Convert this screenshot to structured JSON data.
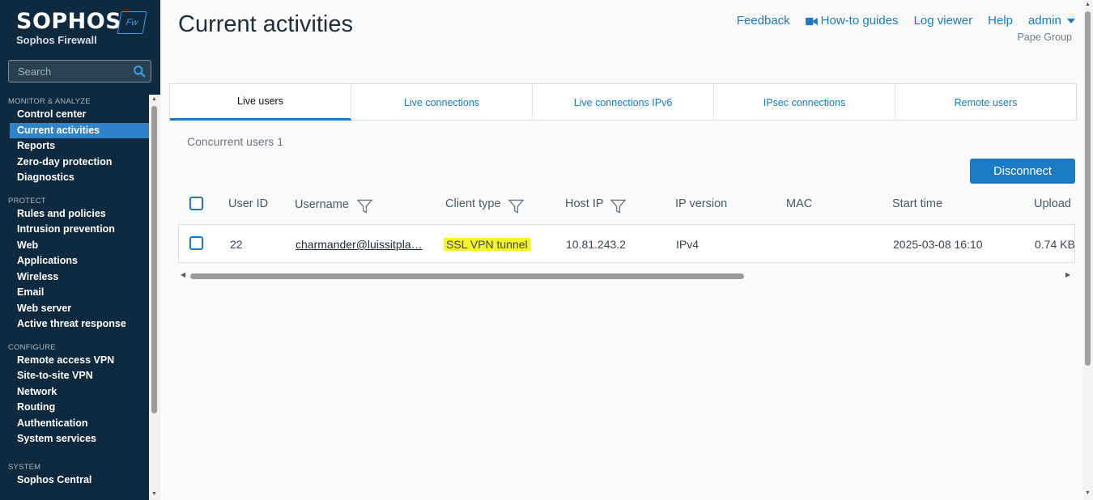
{
  "brand": {
    "logo": "SOPHOS",
    "product": "Sophos Firewall",
    "badge": "Fw"
  },
  "search": {
    "placeholder": "Search"
  },
  "sidebar": {
    "sections": [
      {
        "title": "MONITOR & ANALYZE",
        "items": [
          "Control center",
          "Current activities",
          "Reports",
          "Zero-day protection",
          "Diagnostics"
        ]
      },
      {
        "title": "PROTECT",
        "items": [
          "Rules and policies",
          "Intrusion prevention",
          "Web",
          "Applications",
          "Wireless",
          "Email",
          "Web server",
          "Active threat response"
        ]
      },
      {
        "title": "CONFIGURE",
        "items": [
          "Remote access VPN",
          "Site-to-site VPN",
          "Network",
          "Routing",
          "Authentication",
          "System services"
        ]
      },
      {
        "title": "SYSTEM",
        "items": [
          "Sophos Central"
        ]
      }
    ],
    "active": "Current activities"
  },
  "header": {
    "title": "Current activities",
    "links": {
      "feedback": "Feedback",
      "howto": "How-to guides",
      "logviewer": "Log viewer",
      "help": "Help",
      "admin": "admin"
    },
    "org": "Pape Group"
  },
  "tabs": [
    "Live users",
    "Live connections",
    "Live connections IPv6",
    "IPsec connections",
    "Remote users"
  ],
  "summary": "Concurrent users 1",
  "actions": {
    "disconnect": "Disconnect"
  },
  "table": {
    "columns": [
      "User ID",
      "Username",
      "Client type",
      "Host IP",
      "IP version",
      "MAC",
      "Start time",
      "Upload"
    ],
    "rows": [
      {
        "user_id": "22",
        "username": "charmander@luissitpla…",
        "client_type": "SSL VPN tunnel",
        "host_ip": "10.81.243.2",
        "ip_version": "IPv4",
        "mac": "",
        "start_time": "2025-03-08 16:10",
        "upload": "0.74 KB"
      }
    ]
  },
  "colors": {
    "sidebar_bg": "#0f2a3e",
    "accent": "#1a7ac3",
    "highlight": "#f5f32a"
  }
}
